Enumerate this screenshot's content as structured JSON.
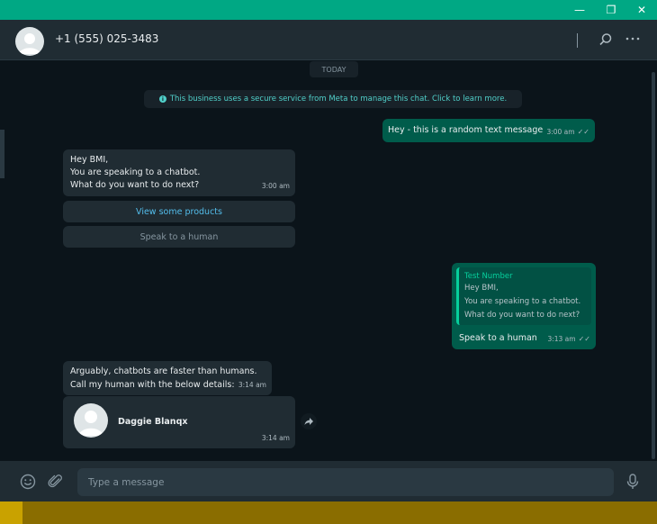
{
  "window": {
    "minimize_glyph": "—",
    "maximize_glyph": "❐",
    "close_glyph": "✕"
  },
  "header": {
    "contact_name": "+1 (555) 025-3483",
    "icons": [
      "avatar-icon",
      "search-icon",
      "more-options-icon"
    ]
  },
  "chat": {
    "date_label": "TODAY",
    "system_message": "This business uses a secure service from Meta to manage this chat. Click to learn more.",
    "messages": [
      {
        "direction": "outgoing",
        "text": "Hey - this is a random text message",
        "time": "3:00 am",
        "ticks": "✓✓"
      },
      {
        "direction": "incoming",
        "lines": [
          "Hey BMI,",
          "You are speaking to a chatbot.",
          "What do you want to do next?"
        ],
        "time": "3:00 am",
        "buttons": [
          "View some products",
          "Speak to a human"
        ]
      },
      {
        "direction": "outgoing",
        "quoted_name": "Test Number",
        "quoted_lines": [
          "Hey BMI,",
          "You are speaking to a chatbot.",
          "What do you want to do next?"
        ],
        "text": "Speak to a human",
        "time": "3:13 am",
        "ticks": "✓✓"
      },
      {
        "direction": "incoming",
        "lines": [
          "Arguably, chatbots are faster than humans.",
          "Call my human with the below details:"
        ],
        "time": "3:14 am"
      },
      {
        "direction": "incoming",
        "type": "contact",
        "contact_name": "Daggie Blanqx",
        "time": "3:14 am"
      }
    ]
  },
  "composer": {
    "placeholder": "Type a message",
    "icons": [
      "emoji-icon",
      "attach-icon",
      "microphone-icon"
    ]
  },
  "colors": {
    "accent": "#00a884",
    "outgoing_bubble": "#005c4b",
    "incoming_bubble": "#202c33",
    "background": "#0b141a",
    "link": "#53bdeb",
    "taskbar": "#8a6d00"
  }
}
